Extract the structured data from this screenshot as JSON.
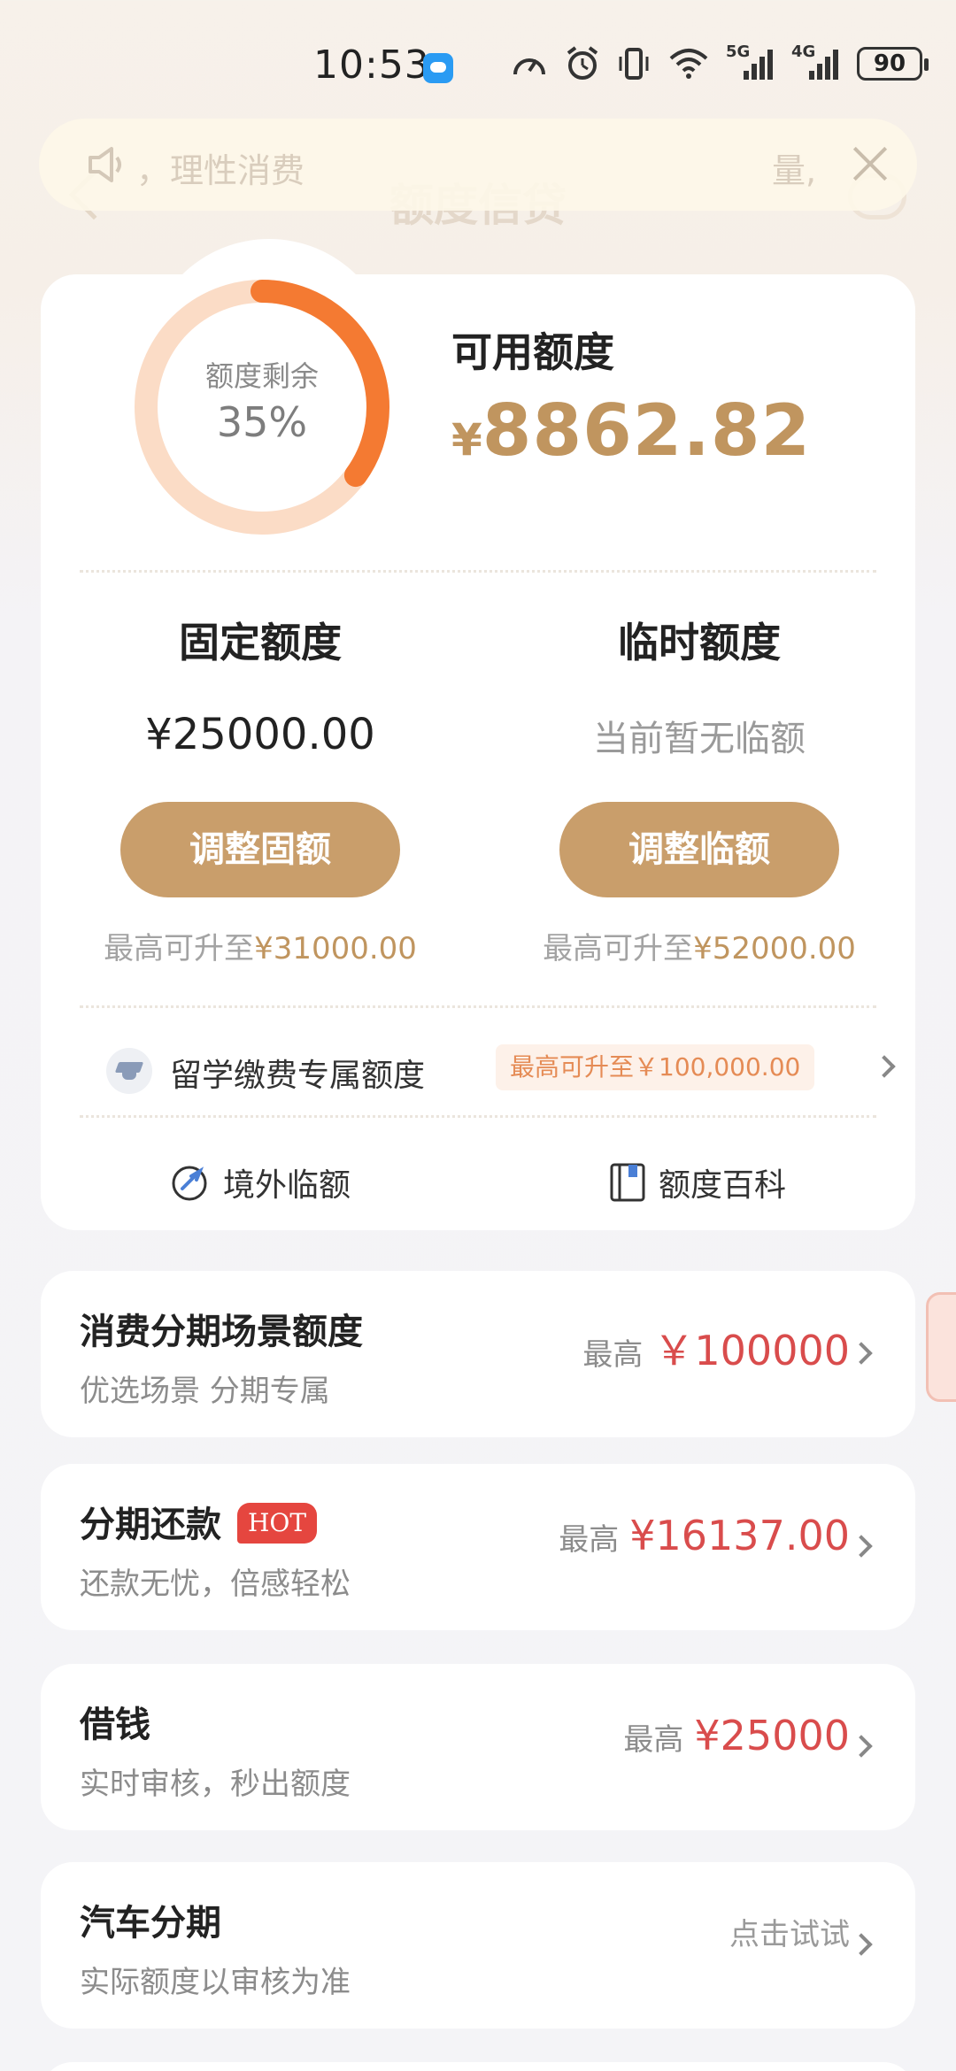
{
  "status_bar": {
    "time": "10:53",
    "battery": "90",
    "icons": [
      "message-app-icon",
      "speedometer-icon",
      "alarm-icon",
      "vibrate-icon",
      "wifi-icon",
      "signal-5g-icon",
      "signal-4g-icon",
      "battery-icon"
    ],
    "signal_5g": "5G",
    "signal_4g": "4G"
  },
  "header": {
    "title": "额度信贷",
    "notice_text": "，理性消费",
    "notice_tail": "量,"
  },
  "credit": {
    "ring_label": "额度剩余",
    "ring_percent": "35%",
    "remaining_fraction": 0.35,
    "available_title": "可用额度",
    "available_currency": "¥",
    "available_amount": "8862.82",
    "fixed": {
      "title": "固定额度",
      "value": "¥25000.00",
      "button": "调整固额",
      "note_prefix": "最高可升至",
      "note_value": "¥31000.00"
    },
    "temporary": {
      "title": "临时额度",
      "value": "当前暂无临额",
      "button": "调整临额",
      "note_prefix": "最高可升至",
      "note_value": "¥52000.00"
    },
    "study": {
      "label": "留学缴费专属额度",
      "badge": "最高可升至￥100,000.00"
    },
    "links": {
      "overseas": "境外临额",
      "wiki": "额度百科"
    }
  },
  "products": [
    {
      "title": "消费分期场景额度",
      "subtitle": "优选场景 分期专属",
      "prefix": "最高",
      "value": "￥100000"
    },
    {
      "title": "分期还款",
      "badge": "HOT",
      "subtitle": "还款无忧，倍感轻松",
      "prefix": "最高",
      "value": "¥16137.00"
    },
    {
      "title": "借钱",
      "subtitle": "实时审核，秒出额度",
      "prefix": "最高",
      "value": "¥25000"
    },
    {
      "title": "汽车分期",
      "subtitle": "实际额度以审核为准",
      "value": "点击试试"
    }
  ],
  "colors": {
    "gold": "#c0955f",
    "button": "#c99e6b",
    "ring_track": "#fbd9c2",
    "ring_fill": "#f47a32",
    "red_value": "#d94c4c",
    "hot_badge": "#e5463f"
  }
}
